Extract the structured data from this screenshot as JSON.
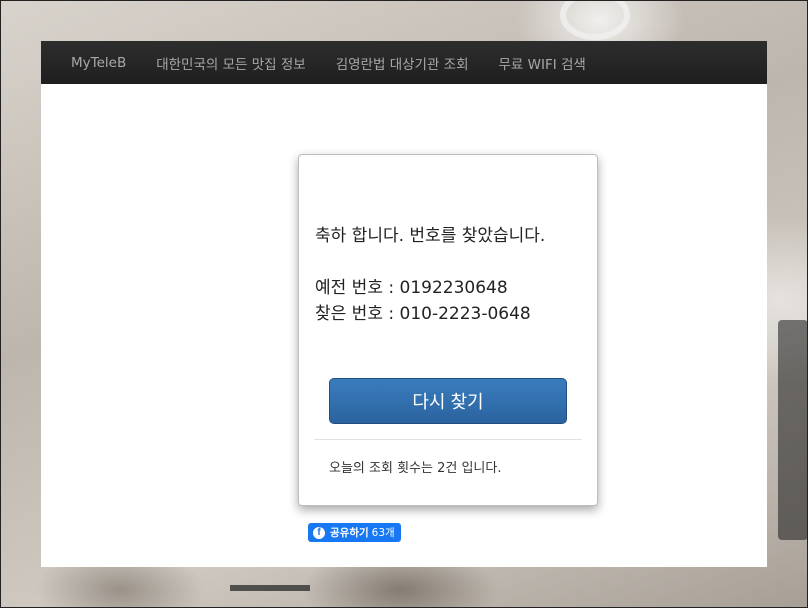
{
  "nav": {
    "items": [
      {
        "label": "MyTeleB"
      },
      {
        "label": "대한민국의 모든 맛집 정보"
      },
      {
        "label": "김영란법 대상기관 조회"
      },
      {
        "label": "무료 WIFI 검색"
      }
    ]
  },
  "result": {
    "message": "축하 합니다. 번호를 찾았습니다.",
    "old_number_text": "예전 번호 : 0192230648",
    "found_number_text": "찾은 번호 : 010-2223-0648",
    "retry_label": "다시 찾기",
    "count_text": "오늘의 조회 횟수는 2건 입니다."
  },
  "share": {
    "icon_glyph": "f",
    "label": "공유하기",
    "count": "63개",
    "color": "#1877f2"
  },
  "colors": {
    "navbar": "#222222",
    "button": "#2f6fae"
  }
}
